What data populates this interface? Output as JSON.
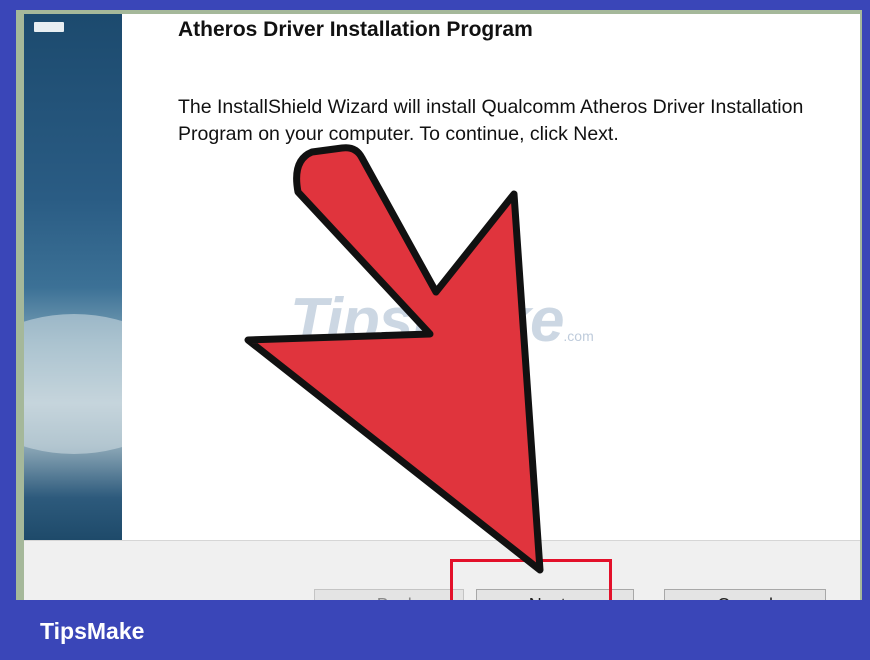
{
  "window": {
    "title": "Atheros Driver Installation Program",
    "description": "The InstallShield Wizard will install Qualcomm Atheros Driver Installation Program on your computer.  To continue, click Next."
  },
  "buttons": {
    "back_label": "< Back",
    "next_label": "Next >",
    "cancel_label": "Cancel"
  },
  "watermark": {
    "text": "TipsMake",
    "suffix": ".com"
  },
  "footer": {
    "brand": "TipsMake"
  },
  "colors": {
    "frame": "#3a46b8",
    "arrow_fill": "#e0343d",
    "highlight": "#e3102a"
  },
  "icons": {
    "pointer": "red-arrow-icon"
  }
}
